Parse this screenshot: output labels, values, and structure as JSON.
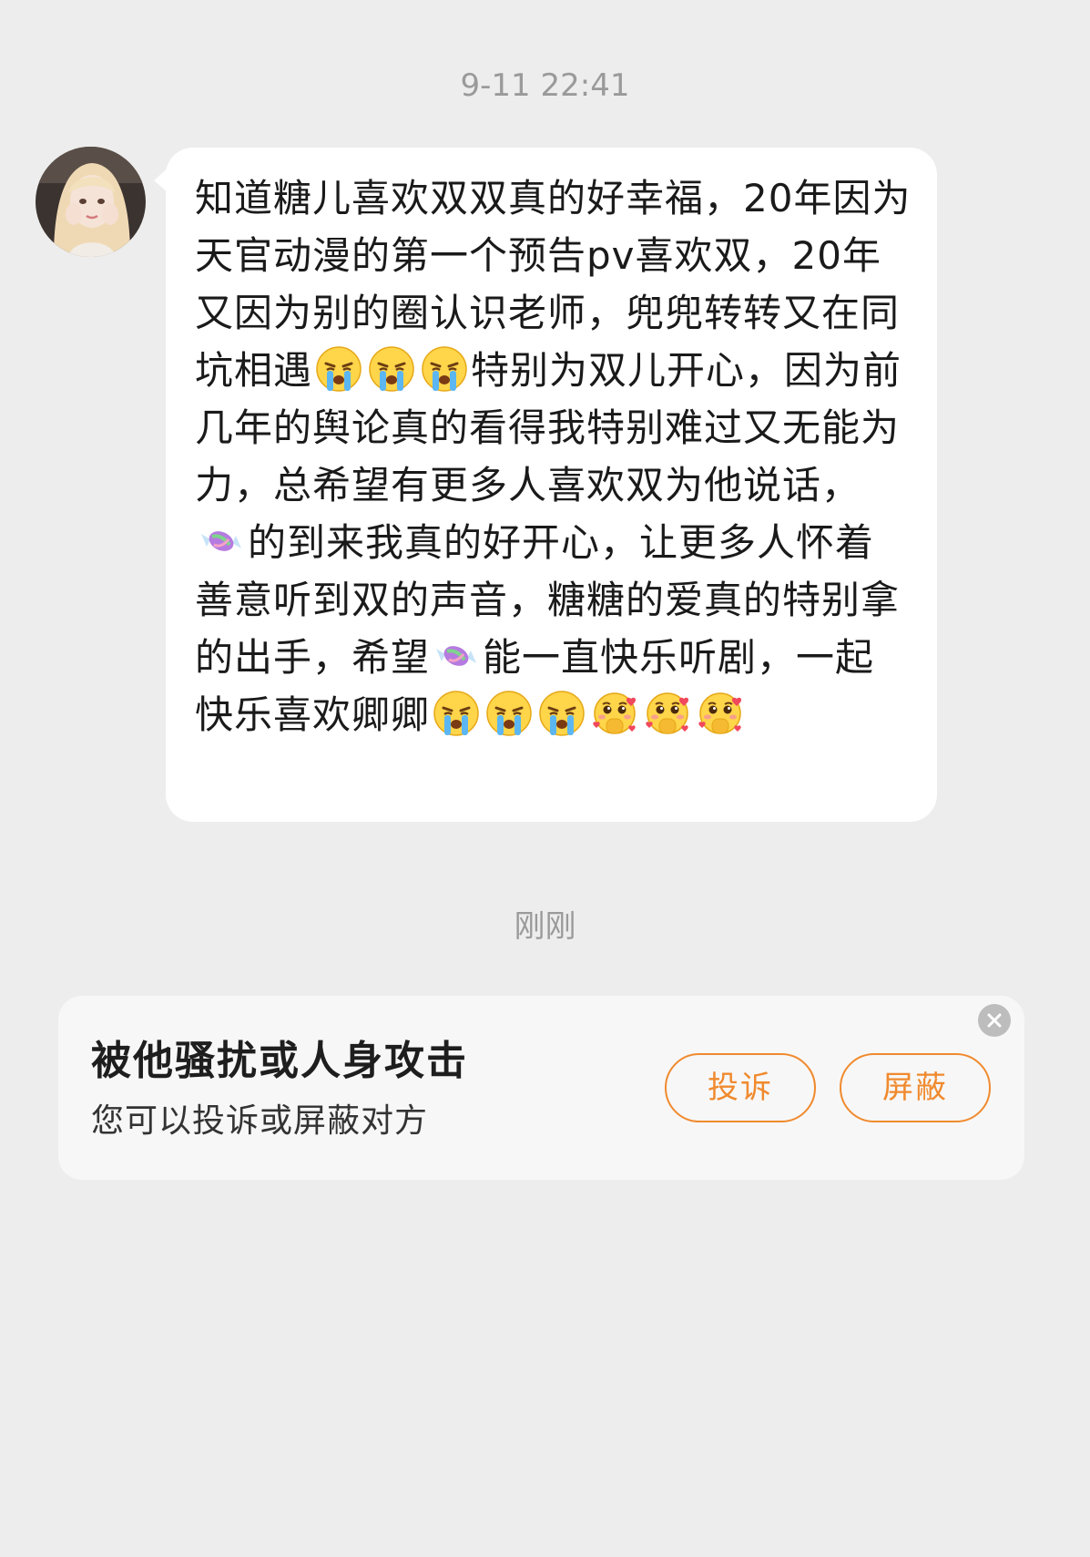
{
  "chat": {
    "timestamp_top": "9-11 22:41",
    "timestamp_recent": "刚刚",
    "message": {
      "parts": [
        {
          "type": "text",
          "value": "知道糖儿喜欢双双真的好幸福，20年因为天官动漫的第一个预告pv喜欢双，20年又因为别的圈认识老师，兜兜转转又在同坑相遇"
        },
        {
          "type": "emoji",
          "icon": "crying-face-icon"
        },
        {
          "type": "emoji",
          "icon": "crying-face-icon"
        },
        {
          "type": "emoji",
          "icon": "crying-face-icon"
        },
        {
          "type": "text",
          "value": "特别为双儿开心，因为前几年的舆论真的看得我特别难过又无能为力，总希望有更多人喜欢双为他说话，"
        },
        {
          "type": "emoji",
          "icon": "candy-icon"
        },
        {
          "type": "text",
          "value": "的到来我真的好开心，让更多人怀着善意听到双的声音，糖糖的爱真的特别拿的出手，希望"
        },
        {
          "type": "emoji",
          "icon": "candy-icon"
        },
        {
          "type": "text",
          "value": "能一直快乐听剧，一起快乐喜欢卿卿"
        },
        {
          "type": "emoji",
          "icon": "crying-face-icon"
        },
        {
          "type": "emoji",
          "icon": "crying-face-icon"
        },
        {
          "type": "emoji",
          "icon": "crying-face-icon"
        },
        {
          "type": "emoji",
          "icon": "pleading-hearts-face-icon"
        },
        {
          "type": "emoji",
          "icon": "pleading-hearts-face-icon"
        },
        {
          "type": "emoji",
          "icon": "pleading-hearts-face-icon"
        }
      ]
    }
  },
  "report_card": {
    "title": "被他骚扰或人身攻击",
    "subtitle": "您可以投诉或屏蔽对方",
    "report_label": "投诉",
    "block_label": "屏蔽"
  },
  "colors": {
    "background": "#EDEDED",
    "bubble": "#FFFFFF",
    "accent": "#F08A2E",
    "timestamp": "#9A9A9A"
  }
}
